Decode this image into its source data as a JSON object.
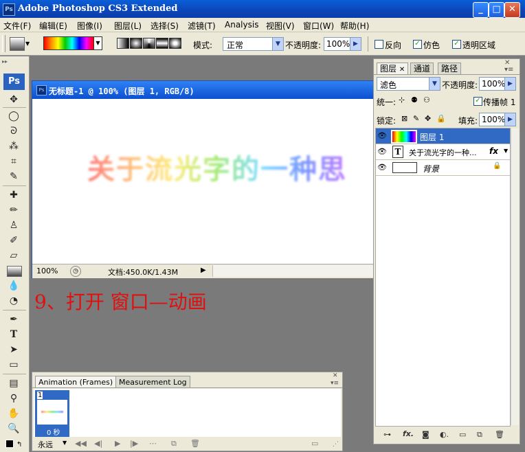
{
  "window": {
    "app_icon": "Ps",
    "title": "Adobe Photoshop CS3 Extended",
    "minimize": "_",
    "maximize": "□",
    "close": "✕"
  },
  "menu": [
    "文件(F)",
    "编辑(E)",
    "图像(I)",
    "图层(L)",
    "选择(S)",
    "滤镜(T)",
    "Analysis",
    "视图(V)",
    "窗口(W)",
    "帮助(H)"
  ],
  "options": {
    "mode_label": "模式:",
    "mode_value": "正常",
    "opacity_label": "不透明度:",
    "opacity_value": "100%",
    "reverse_label": "反向",
    "reverse_checked": false,
    "dither_label": "仿色",
    "dither_checked": true,
    "transparency_label": "透明区域",
    "transparency_checked": true
  },
  "toolbox": {
    "logo": "Ps"
  },
  "document": {
    "title": "无标题-1 @ 100% (图层 1, RGB/8)",
    "canvas_text": "关于流光字的一种思",
    "zoom": "100%",
    "doc_info": "文档:450.0K/1.43M"
  },
  "instruction": "9、打开 窗口—动画",
  "layers_panel": {
    "tabs": [
      "图层",
      "通道",
      "路径"
    ],
    "blend_mode": "滤色",
    "opacity_label": "不透明度:",
    "opacity_value": "100%",
    "unify_label": "统一:",
    "propagate_label": "传播帧 1",
    "lock_label": "锁定:",
    "fill_label": "填充:",
    "fill_value": "100%",
    "layers": [
      {
        "name": "图层 1",
        "selected": true
      },
      {
        "name": "关于流光字的一种...",
        "type": "text",
        "fx": "fx"
      },
      {
        "name": "背景",
        "locked": true
      }
    ]
  },
  "animation_panel": {
    "tabs": [
      "Animation (Frames)",
      "Measurement Log"
    ],
    "frame_number": "1",
    "frame_delay": "0 秒",
    "loop": "永远"
  },
  "colors": {
    "title_bar": "#0c45b8",
    "panel_bg": "#ece9d8",
    "workspace": "#7a7a7a",
    "selected_layer": "#316ac5",
    "instruction_text": "#e01010"
  }
}
